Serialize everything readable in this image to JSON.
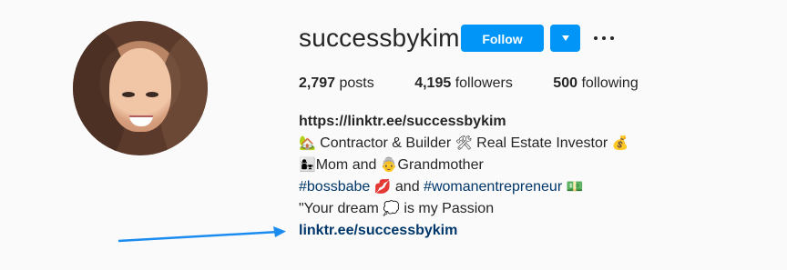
{
  "profile": {
    "username": "successbykim",
    "follow_label": "Follow",
    "stats": {
      "posts_count": "2,797",
      "posts_label": "posts",
      "followers_count": "4,195",
      "followers_label": "followers",
      "following_count": "500",
      "following_label": "following"
    },
    "bio": {
      "link_top": "https://linktr.ee/successbykim",
      "line2_emoji1": "🏡",
      "line2_text1": "Contractor & Builder",
      "line2_emoji2": "🛠",
      "line2_text2": "Real Estate Investor",
      "line2_emoji3": "💰",
      "line3_emoji1": "👩‍👧",
      "line3_text1": "Mom and",
      "line3_emoji2": "👵",
      "line3_text2": "Grandmother",
      "line4_tag1": "#bossbabe",
      "line4_emoji1": "💋",
      "line4_and": "and",
      "line4_tag2": "#womanentrepreneur",
      "line4_emoji2": "💵",
      "line5_text1": "\"Your dream",
      "line5_emoji": "💭",
      "line5_text2": "is my Passion",
      "link_bottom": "linktr.ee/successbykim"
    }
  },
  "colors": {
    "accent": "#0095f6",
    "tag": "#00376b",
    "arrow": "#1a8cf0",
    "background": "#fafafa"
  }
}
